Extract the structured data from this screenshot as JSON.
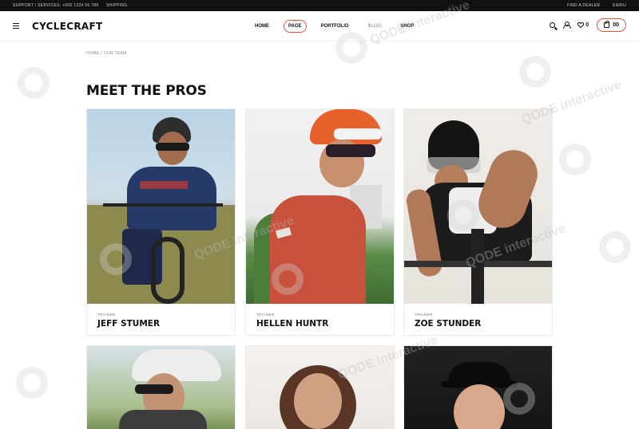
{
  "topbar": {
    "support_text": "SUPPORT / SERVICES: +000 1234 56 789",
    "shipping_text": "SHIPPING",
    "find_dealer": "FIND A DEALER",
    "language": "EN/RU"
  },
  "header": {
    "logo": "CYCLECRAFT",
    "nav": {
      "home": "HOME",
      "page": "PAGE",
      "portfolio": "PORTFOLIO",
      "blog": "BLOG",
      "shop": "SHOP"
    },
    "wishlist_count": "0",
    "cart_count": "00"
  },
  "breadcrumb": {
    "home": "HOME",
    "separator": "/",
    "current": "OUR TEAM"
  },
  "page": {
    "title": "MEET THE PROS"
  },
  "team": [
    {
      "role": "TRAINER",
      "name": "JEFF STUMER"
    },
    {
      "role": "TRAINER",
      "name": "HELLEN HUNTR"
    },
    {
      "role": "TRAINER",
      "name": "ZOE STUNDER"
    }
  ],
  "watermark": "QODE interactive",
  "colors": {
    "accent": "#e4572e",
    "topbar_bg": "#111111"
  }
}
